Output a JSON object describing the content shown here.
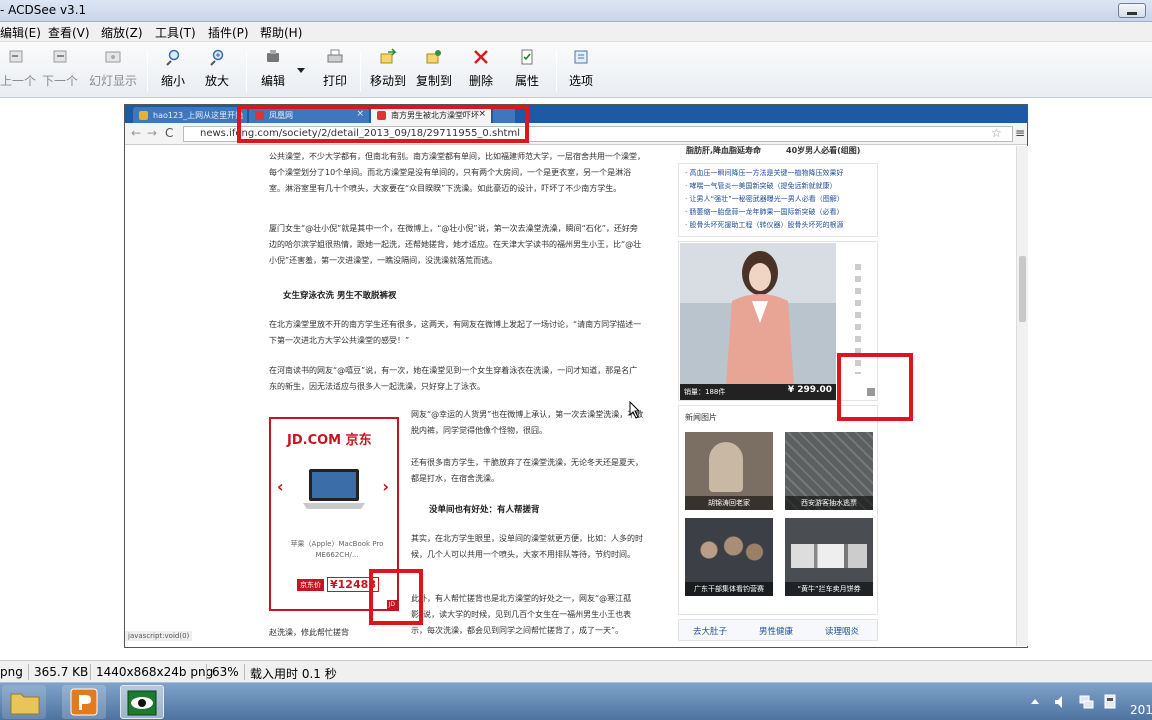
{
  "window": {
    "title": "- ACDSee v3.1"
  },
  "menu": [
    "编辑(E)",
    "查看(V)",
    "缩放(Z)",
    "工具(T)",
    "插件(P)",
    "帮助(H)"
  ],
  "toolbar": {
    "prev": "上一个",
    "next": "下一个",
    "slideshow": "幻灯显示",
    "zoom_out": "缩小",
    "zoom_in": "放大",
    "edit": "编辑",
    "print": "打印",
    "move_to": "移动到",
    "copy_to": "复制到",
    "delete": "删除",
    "properties": "属性",
    "options": "选项"
  },
  "browser": {
    "tabs": [
      "hao123_上网从这里开始",
      "凤凰网",
      "南方男生被北方澡堂吓坏"
    ],
    "url": "news.ifeng.com/society/2/detail_2013_09/18/29711955_0.shtml",
    "status_link": "javascript:void(0)"
  },
  "article": {
    "paragraphs": [
      "公共澡堂，不少大学都有，但南北有别。南方澡堂都有单间，比如福建师范大学，一层宿舍共用一个澡堂，每个澡堂划分了10个单间。而北方澡堂是没有单间的，只有两个大房间，一个是更衣室，另一个是淋浴室。淋浴室里有几十个喷头，大家要在“众目睽睽”下洗澡。如此豪迈的设计，吓坏了不少南方学生。",
      "厦门女生“@壮小倪”就是其中一个，在微博上，“@壮小倪”说，第一次去澡堂洗澡，瞬间“石化”，还好旁边的哈尔滨学姐很热情，跟她一起洗，还帮她搓背，她才适应。在天津大学读书的福州男生小王，比“@壮小倪”还害羞，第一次进澡堂，一瞧没隔间，没洗澡就落荒而逃。",
      "在北方澡堂里放不开的南方学生还有很多，这两天，有网友在微博上发起了一场讨论，“请南方同学描述一下第一次进北方大学公共澡堂的感受！”",
      "在河南读书的网友“@嘻豆”说，有一次，她在澡堂见到一个女生穿着泳衣在洗澡，一问才知道，那是名广东的新生，因无法适应与很多人一起洗澡，只好穿上了泳衣。",
      "网友“@幸运的人货男”也在微博上承认，第一次去澡堂洗澡，不敢脱内裤，同学觉得他像个怪物，很囧。",
      "还有很多南方学生，干脆放弃了在澡堂洗澡，无论冬天还是夏天，都是打水，在宿舍洗澡。",
      "其实，在北方学生眼里，没单间的澡堂就更方便，比如：人多的时候，几个人可以共用一个喷头，大家不用排队等待，节约时间。",
      "此外，有人帮忙搓背也是北方澡堂的好处之一，网友“@寒江孤影”说，读大学的时候，见到几百个女生在一福州男生小王也表示，每次洗澡，都会见到同学之间帮忙搓背了，成了一天”。"
    ],
    "headings": [
      "女生穿泳衣洗 男生不敢脱裤衩",
      "没单间也有好处：有人帮搓背"
    ],
    "bottom_cut": "赵洗澡，修此帮忙搓背"
  },
  "jd_ad": {
    "logo": "JD.COM 京东",
    "product": "苹果（Apple）MacBook Pro ME662CH/...",
    "price_tag": "京东价",
    "price": "¥12488",
    "badge": "JD"
  },
  "sidebar": {
    "banner_left": "脂肪肝,降血脂延寿命",
    "banner_right": "40岁男人必看(组图)",
    "links": [
      "· 高血压一瞬间降压一方法是关键一植物降压效果好",
      "· 哮喘一气管炎一美国新突破（提免远新就就康）",
      "· 让男人“强壮”一秘密武器曝光一男人必看（图解）",
      "· 肠萎缩一胎盘蒜一龙年肺果一国际新突破（必看）",
      "· 股骨头坏死援助工程（转仪器）股骨头坏死的根源"
    ],
    "product_sales": "销量：188件",
    "product_price": "¥ 299.00",
    "news_pics_title": "新闻图片",
    "photos": [
      "胡锦涛回老家",
      "西安游客抽水逃票",
      "广东干部集体看钓营赛",
      "“黄牛”拦车卖月饼券"
    ],
    "tabs": [
      "去大肚子",
      "男性健康",
      "读理咽炎"
    ]
  },
  "status": {
    "filetype": "png",
    "size": "365.7 KB",
    "dims": "1440x868x24b png",
    "zoom": "63%",
    "load_time": "载入用时 0.1 秒"
  },
  "taskbar": {
    "clock": "201"
  },
  "colors": {
    "highlight_red": "#e1141e",
    "jd_red": "#c8141e",
    "chrome_blue": "#1c5aa3"
  }
}
